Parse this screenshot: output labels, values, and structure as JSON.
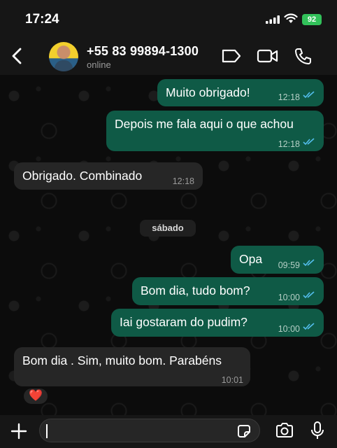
{
  "status_bar": {
    "time": "17:24",
    "battery": "92"
  },
  "header": {
    "contact_name": "+55 83 99894-1300",
    "status": "online"
  },
  "messages": [
    {
      "direction": "out",
      "text": "Muito obrigado!",
      "time": "12:18",
      "read": true
    },
    {
      "direction": "out",
      "text": "Depois me fala aqui o que achou",
      "time": "12:18",
      "read": true
    },
    {
      "direction": "in",
      "text": "Obrigado. Combinado",
      "time": "12:18"
    },
    {
      "direction": "out",
      "text": "Opa",
      "time": "09:59",
      "read": true
    },
    {
      "direction": "out",
      "text": "Bom dia, tudo bom?",
      "time": "10:00",
      "read": true
    },
    {
      "direction": "out",
      "text": "Iai gostaram do pudim?",
      "time": "10:00",
      "read": true
    },
    {
      "direction": "in",
      "text": "Bom dia . Sim, muito bom. Parabéns",
      "time": "10:01",
      "reaction": "❤️"
    }
  ],
  "day_separator": "sábado",
  "input": {
    "placeholder": "",
    "value": ""
  },
  "colors": {
    "outgoing_bubble": "#0f5a46",
    "incoming_bubble": "#262626",
    "read_ticks": "#53bdeb"
  }
}
